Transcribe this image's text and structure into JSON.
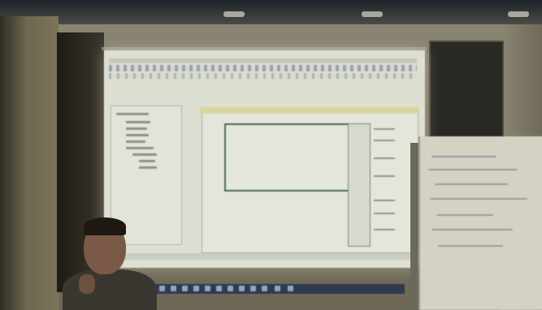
{
  "scene": {
    "kind": "photo",
    "subject": "projector-screen-with-application",
    "colors": {
      "screen": "#dcdfd2",
      "frame_accent": "#4d6b4e",
      "taskbar": "#2f3a4e",
      "background_wall": "#7c7664"
    },
    "icons": [
      "ceiling-light-icon",
      "taskbar-icon"
    ]
  }
}
